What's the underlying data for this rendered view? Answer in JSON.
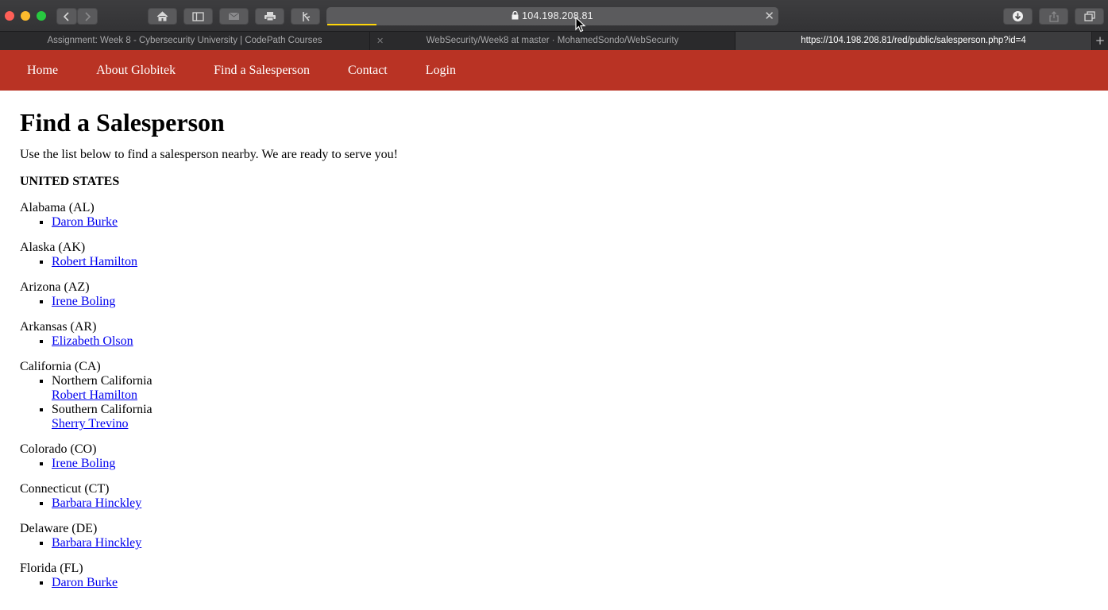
{
  "browser": {
    "url": "104.198.208.81",
    "tabs": [
      {
        "title": "Assignment: Week 8 - Cybersecurity University | CodePath Courses"
      },
      {
        "title": "WebSecurity/Week8 at master · MohamedSondo/WebSecurity"
      },
      {
        "title": "https://104.198.208.81/red/public/salesperson.php?id=4"
      }
    ]
  },
  "nav": {
    "items": [
      "Home",
      "About Globitek",
      "Find a Salesperson",
      "Contact",
      "Login"
    ]
  },
  "page": {
    "title": "Find a Salesperson",
    "intro": "Use the list below to find a salesperson nearby. We are ready to serve you!",
    "country": "UNITED STATES"
  },
  "states": [
    {
      "name": "Alabama (AL)",
      "people": [
        "Daron Burke"
      ]
    },
    {
      "name": "Alaska (AK)",
      "people": [
        "Robert Hamilton"
      ]
    },
    {
      "name": "Arizona (AZ)",
      "people": [
        "Irene Boling"
      ]
    },
    {
      "name": "Arkansas (AR)",
      "people": [
        "Elizabeth Olson"
      ]
    },
    {
      "name": "California (CA)",
      "regions": [
        {
          "name": "Northern California",
          "person": "Robert Hamilton"
        },
        {
          "name": "Southern California",
          "person": "Sherry Trevino"
        }
      ]
    },
    {
      "name": "Colorado (CO)",
      "people": [
        "Irene Boling"
      ]
    },
    {
      "name": "Connecticut (CT)",
      "people": [
        "Barbara Hinckley"
      ]
    },
    {
      "name": "Delaware (DE)",
      "people": [
        "Barbara Hinckley"
      ]
    },
    {
      "name": "Florida (FL)",
      "people": [
        "Daron Burke"
      ]
    }
  ]
}
